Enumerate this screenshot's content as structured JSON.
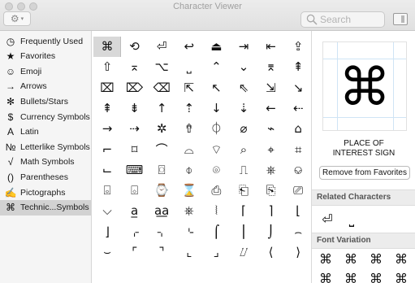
{
  "window": {
    "title": "Character Viewer"
  },
  "toolbar": {
    "gear_glyph": "⚙",
    "caret_glyph": "▾",
    "search_placeholder": "Search"
  },
  "sidebar": {
    "items": [
      {
        "icon": "◷",
        "icon_name": "clock-icon",
        "label": "Frequently Used"
      },
      {
        "icon": "★",
        "icon_name": "star-icon",
        "label": "Favorites"
      },
      {
        "icon": "☺",
        "icon_name": "smiley-icon",
        "label": "Emoji"
      },
      {
        "icon": "→",
        "icon_name": "arrow-icon",
        "label": "Arrows"
      },
      {
        "icon": "✻",
        "icon_name": "bullet-star-icon",
        "label": "Bullets/Stars"
      },
      {
        "icon": "$",
        "icon_name": "dollar-icon",
        "label": "Currency Symbols"
      },
      {
        "icon": "A",
        "icon_name": "latin-icon",
        "label": "Latin"
      },
      {
        "icon": "№",
        "icon_name": "numero-icon",
        "label": "Letterlike Symbols"
      },
      {
        "icon": "√",
        "icon_name": "square-root-icon",
        "label": "Math Symbols"
      },
      {
        "icon": "()",
        "icon_name": "parentheses-icon",
        "label": "Parentheses"
      },
      {
        "icon": "✍",
        "icon_name": "pictograph-icon",
        "label": "Pictographs"
      },
      {
        "icon": "⌘",
        "icon_name": "command-icon",
        "label": "Technic...Symbols"
      }
    ],
    "selected_index": 11
  },
  "grid": {
    "selected": [
      0,
      0
    ],
    "rows": [
      [
        "⌘",
        "⟲",
        "⏎",
        "↩",
        "⏏",
        "⇥",
        "⇤",
        "⇪"
      ],
      [
        "⇧",
        "⌅",
        "⌥",
        "⎵",
        "⌃",
        "⌄",
        "⌆",
        "⇞"
      ],
      [
        "⌧",
        "⌦",
        "⌫",
        "⇱",
        "↖",
        "⇖",
        "⇲",
        "↘"
      ],
      [
        "⇞",
        "⇟",
        "↑",
        "⇡",
        "↓",
        "⇣",
        "←",
        "⇠"
      ],
      [
        "→",
        "⇢",
        "✲",
        "⇮",
        "⏀",
        "⌀",
        "⌁",
        "⌂"
      ],
      [
        "⌐",
        "⌑",
        "⌒",
        "⌓",
        "⌔",
        "⌕",
        "⌖",
        "⌗"
      ],
      [
        "⌙",
        "⌨",
        "⌼",
        "⌽",
        "⌾",
        "⎍",
        "⎈",
        "⎉"
      ],
      [
        "⌻",
        "⌺",
        "⌚",
        "⌛",
        "⎙",
        "⎗",
        "⎘",
        "⎚"
      ],
      [
        "⌵",
        "a̲",
        "a͟a",
        "⎈",
        "⦚",
        "⌈",
        "⌉",
        "⌊"
      ],
      [
        "⌋",
        "⌌",
        "⌍",
        "⌎",
        "⌠",
        "⎮",
        "⌡",
        "⌢"
      ],
      [
        "⌣",
        "⌜",
        "⌝",
        "⌞",
        "⌟",
        "⌰",
        "⟨",
        "⟩"
      ]
    ]
  },
  "detail": {
    "glyph": "⌘",
    "name_line1": "PLACE OF",
    "name_line2": "INTEREST SIGN",
    "remove_button": "Remove from Favorites",
    "related_header": "Related Characters",
    "related": [
      "⏎",
      "⎵"
    ],
    "font_variation_header": "Font Variation",
    "font_variations": [
      "⌘",
      "⌘",
      "⌘",
      "⌘",
      "⌘",
      "⌘",
      "⌘",
      "⌘"
    ]
  }
}
